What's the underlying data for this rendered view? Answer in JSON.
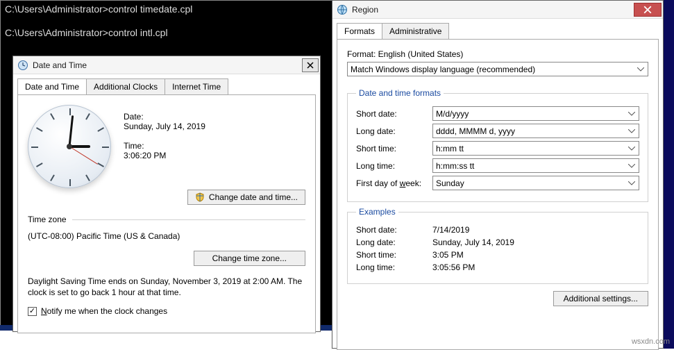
{
  "console": {
    "line1_prompt": "C:\\Users\\Administrator>",
    "line1_cmd": "control timedate.cpl",
    "line2_prompt": "C:\\Users\\Administrator>",
    "line2_cmd": "control intl.cpl"
  },
  "dateTimeDlg": {
    "title": "Date and Time",
    "tabs": {
      "t1": "Date and Time",
      "t2": "Additional Clocks",
      "t3": "Internet Time"
    },
    "date_label": "Date:",
    "date_value": "Sunday, July 14, 2019",
    "time_label": "Time:",
    "time_value": "3:06:20 PM",
    "change_dt_btn": "Change date and time...",
    "tz_heading": "Time zone",
    "tz_value": "(UTC-08:00) Pacific Time (US & Canada)",
    "change_tz_btn": "Change time zone...",
    "dst_text": "Daylight Saving Time ends on Sunday, November 3, 2019 at 2:00 AM. The clock is set to go back 1 hour at that time.",
    "notify_label_pre": "N",
    "notify_label_rest": "otify me when the clock changes"
  },
  "regionDlg": {
    "title": "Region",
    "tabs": {
      "t1": "Formats",
      "t2": "Administrative"
    },
    "format_label": "Format: ",
    "format_value": "English (United States)",
    "format_select": "Match Windows display language (recommended)",
    "formats_heading": "Date and time formats",
    "short_date_lbl": "Short date:",
    "short_date_val": "M/d/yyyy",
    "long_date_lbl": "Long date:",
    "long_date_val": "dddd, MMMM d, yyyy",
    "short_time_lbl": "Short time:",
    "short_time_val": "h:mm tt",
    "long_time_lbl": "Long time:",
    "long_time_val": "h:mm:ss tt",
    "first_day_lbl_pre": "First day of ",
    "first_day_lbl_u": "w",
    "first_day_lbl_post": "eek:",
    "first_day_val": "Sunday",
    "examples_heading": "Examples",
    "ex_short_date_lbl": "Short date:",
    "ex_short_date_val": "7/14/2019",
    "ex_long_date_lbl": "Long date:",
    "ex_long_date_val": "Sunday, July 14, 2019",
    "ex_short_time_lbl": "Short time:",
    "ex_short_time_val": "3:05 PM",
    "ex_long_time_lbl": "Long time:",
    "ex_long_time_val": "3:05:56 PM",
    "additional_btn": "Additional settings..."
  },
  "watermark": "wsxdn.com"
}
